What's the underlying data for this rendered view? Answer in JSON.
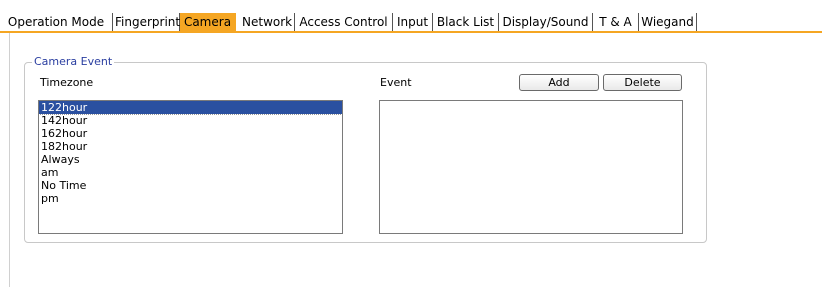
{
  "tabs": [
    {
      "label": "Operation Mode",
      "active": false
    },
    {
      "label": "Fingerprint",
      "active": false
    },
    {
      "label": "Camera",
      "active": true
    },
    {
      "label": "Network",
      "active": false
    },
    {
      "label": "Access Control",
      "active": false
    },
    {
      "label": "Input",
      "active": false
    },
    {
      "label": "Black List",
      "active": false
    },
    {
      "label": "Display/Sound",
      "active": false
    },
    {
      "label": "T & A",
      "active": false
    },
    {
      "label": "Wiegand",
      "active": false
    }
  ],
  "camera_event": {
    "group_title": "Camera Event",
    "timezone_label": "Timezone",
    "event_label": "Event",
    "add_label": "Add",
    "delete_label": "Delete",
    "timezones": [
      "122hour",
      "142hour",
      "162hour",
      "182hour",
      "Always",
      "am",
      "No Time",
      "pm"
    ],
    "selected_timezone": "122hour",
    "events": []
  },
  "colors": {
    "tab_accent": "#f5a623",
    "selection": "#2a50a0",
    "group_title": "#2a3ea0"
  }
}
